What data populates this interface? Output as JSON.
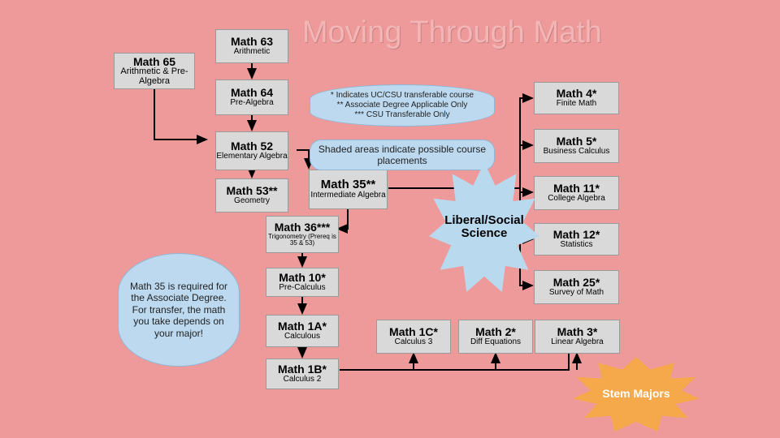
{
  "title": "Moving Through Math",
  "legend": {
    "transferable_note": "* Indicates UC/CSU transferable course\n** Associate Degree Applicable Only\n*** CSU Transferable Only",
    "shaded_note": "Shaded areas indicate possible course placements"
  },
  "callout": "Math 35 is required for the Associate Degree. For transfer, the math you take depends on your major!",
  "starburst_labels": {
    "liberal": "Liberal/Social Science",
    "stem": "Stem Majors"
  },
  "nodes": [
    {
      "id": "math65",
      "title": "Math 65",
      "sub": "Arithmetic & Pre-Algebra"
    },
    {
      "id": "math63",
      "title": "Math 63",
      "sub": "Arithmetic"
    },
    {
      "id": "math64",
      "title": "Math 64",
      "sub": "Pre-Algebra"
    },
    {
      "id": "math52",
      "title": "Math 52",
      "sub": "Elementary Algebra"
    },
    {
      "id": "math53",
      "title": "Math  53**",
      "sub": "Geometry"
    },
    {
      "id": "math35",
      "title": "Math 35**",
      "sub": "Intermediate Algebra"
    },
    {
      "id": "math36",
      "title": "Math  36***",
      "sub": "Trigonometry (Prereq is 35 & 53)"
    },
    {
      "id": "math10",
      "title": "Math 10*",
      "sub": "Pre-Calculus"
    },
    {
      "id": "math1a",
      "title": "Math 1A*",
      "sub": "Calculous"
    },
    {
      "id": "math1b",
      "title": "Math 1B*",
      "sub": "Calculus 2"
    },
    {
      "id": "math1c",
      "title": "Math 1C*",
      "sub": "Calculus 3"
    },
    {
      "id": "math2",
      "title": "Math 2*",
      "sub": "Diff Equations"
    },
    {
      "id": "math3",
      "title": "Math 3*",
      "sub": "Linear Algebra"
    },
    {
      "id": "math4",
      "title": "Math 4*",
      "sub": "Finite Math"
    },
    {
      "id": "math5",
      "title": "Math 5*",
      "sub": "Business Calculus"
    },
    {
      "id": "math11",
      "title": "Math 11*",
      "sub": "College Algebra"
    },
    {
      "id": "math12",
      "title": "Math 12*",
      "sub": "Statistics"
    },
    {
      "id": "math25",
      "title": "Math 25*",
      "sub": "Survey of Math"
    }
  ]
}
